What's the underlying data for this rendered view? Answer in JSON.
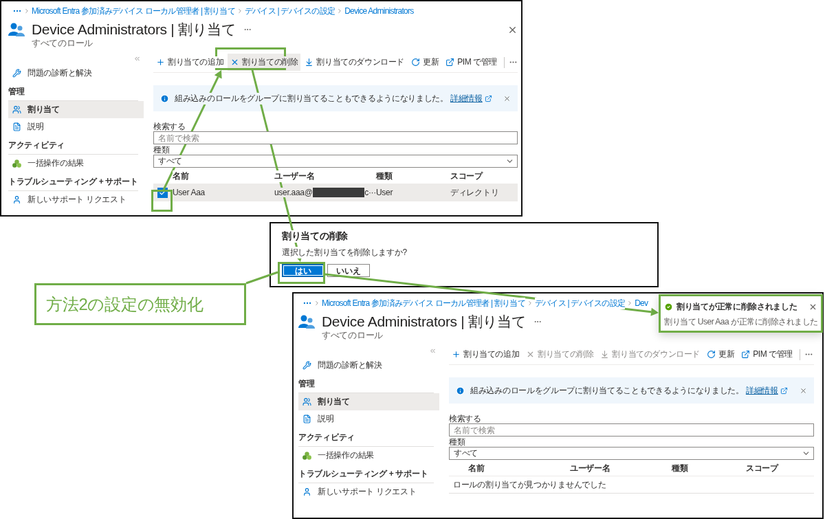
{
  "screens": [
    {
      "breadcrumb": [
        "Microsoft Entra 参加済みデバイス ローカル管理者 | 割り当て",
        "デバイス | デバイスの設定",
        "Device Administrators"
      ],
      "title": "Device Administrators | 割り当て",
      "subtitle": "すべてのロール",
      "closable": true,
      "sidebar": [
        {
          "kind": "item",
          "label": "問題の診断と解決",
          "selected": false
        },
        {
          "kind": "heading",
          "label": "管理"
        },
        {
          "kind": "item",
          "label": "割り当て",
          "selected": true
        },
        {
          "kind": "item",
          "label": "説明",
          "selected": false
        },
        {
          "kind": "heading",
          "label": "アクティビティ"
        },
        {
          "kind": "item",
          "label": "一括操作の結果",
          "selected": false
        },
        {
          "kind": "heading",
          "label": "トラブルシューティング + サポート"
        },
        {
          "kind": "item",
          "label": "新しいサポート リクエスト",
          "selected": false
        }
      ],
      "toolbar": [
        {
          "label": "割り当ての追加",
          "disabled": false,
          "hovered": false
        },
        {
          "label": "割り当ての削除",
          "disabled": false,
          "hovered": true
        },
        {
          "label": "割り当てのダウンロード",
          "disabled": false,
          "hovered": false
        },
        {
          "label": "更新",
          "disabled": false,
          "hovered": false
        },
        {
          "label": "PIM で管理",
          "disabled": false,
          "hovered": false
        }
      ],
      "banner": {
        "text": "組み込みのロールをグループに割り当てることもできるようになりました。",
        "link": "詳細情報"
      },
      "search": {
        "label": "検索する",
        "placeholder": "名前で検索"
      },
      "type_filter": {
        "label": "種類",
        "value": "すべて"
      },
      "columns": [
        "名前",
        "ユーザー名",
        "種類",
        "スコープ"
      ],
      "rows": [
        {
          "checked": true,
          "selected": true,
          "name": "User Aaa",
          "username_start": "user.aaa@",
          "username_end": "c···",
          "type": "User",
          "scope": "ディレクトリ"
        }
      ]
    },
    {
      "breadcrumb": [
        "Microsoft Entra 参加済みデバイス ローカル管理者 | 割り当て",
        "デバイス | デバイスの設定",
        "Dev"
      ],
      "title": "Device Administrators | 割り当て",
      "subtitle": "すべてのロール",
      "closable": false,
      "sidebar": [
        {
          "kind": "item",
          "label": "問題の診断と解決",
          "selected": false
        },
        {
          "kind": "heading",
          "label": "管理"
        },
        {
          "kind": "item",
          "label": "割り当て",
          "selected": true
        },
        {
          "kind": "item",
          "label": "説明",
          "selected": false
        },
        {
          "kind": "heading",
          "label": "アクティビティ"
        },
        {
          "kind": "item",
          "label": "一括操作の結果",
          "selected": false
        },
        {
          "kind": "heading",
          "label": "トラブルシューティング + サポート"
        },
        {
          "kind": "item",
          "label": "新しいサポート リクエスト",
          "selected": false
        }
      ],
      "toolbar": [
        {
          "label": "割り当ての追加",
          "disabled": false,
          "hovered": false
        },
        {
          "label": "割り当ての削除",
          "disabled": true,
          "hovered": false
        },
        {
          "label": "割り当てのダウンロード",
          "disabled": true,
          "hovered": false
        },
        {
          "label": "更新",
          "disabled": false,
          "hovered": false
        },
        {
          "label": "PIM で管理",
          "disabled": false,
          "hovered": false
        }
      ],
      "banner": {
        "text": "組み込みのロールをグループに割り当てることもできるようになりました。",
        "link": "詳細情報"
      },
      "search": {
        "label": "検索する",
        "placeholder": "名前で検索"
      },
      "type_filter": {
        "label": "種類",
        "value": "すべて"
      },
      "columns": [
        "名前",
        "ユーザー名",
        "種類",
        "スコープ"
      ],
      "empty_message": "ロールの割り当てが見つかりませんでした"
    }
  ],
  "dialog": {
    "title": "割り当ての削除",
    "message": "選択した割り当てを削除しますか?",
    "buttons": [
      {
        "label": "はい",
        "primary": true
      },
      {
        "label": "いいえ",
        "primary": false
      }
    ]
  },
  "callout": {
    "text": "方法2の設定の無効化"
  },
  "toast": {
    "title": "割り当てが正常に削除されました",
    "message": "割り当て User Aaa が正常に削除されました"
  }
}
